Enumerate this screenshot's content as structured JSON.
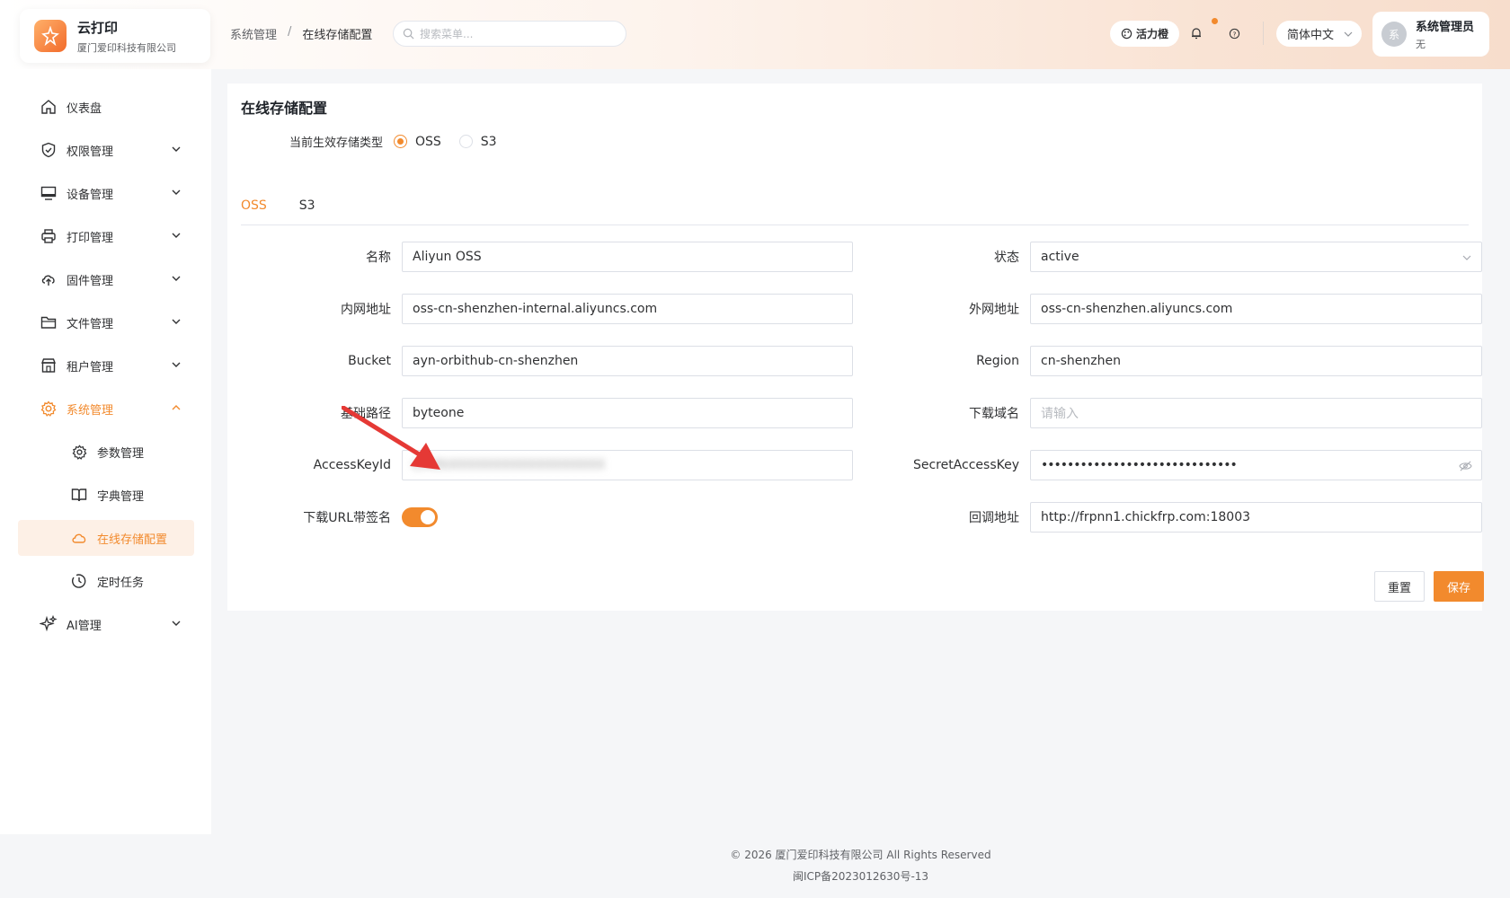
{
  "brand": {
    "title": "云打印",
    "subtitle": "厦门爱印科技有限公司"
  },
  "breadcrumb": {
    "parent": "系统管理",
    "separator": "/",
    "current": "在线存储配置"
  },
  "search": {
    "placeholder": "搜索菜单..."
  },
  "header": {
    "vitality_label": "活力橙",
    "language": "简体中文",
    "avatar_text": "系",
    "user_name": "系统管理员",
    "user_role": "无",
    "accent": "#f28a2d"
  },
  "sidebar": {
    "items": [
      {
        "label": "仪表盘",
        "icon": "home-icon"
      },
      {
        "label": "权限管理",
        "icon": "shield-icon"
      },
      {
        "label": "设备管理",
        "icon": "monitor-icon"
      },
      {
        "label": "打印管理",
        "icon": "printer-icon"
      },
      {
        "label": "固件管理",
        "icon": "cloud-upload-icon"
      },
      {
        "label": "文件管理",
        "icon": "folder-icon"
      },
      {
        "label": "租户管理",
        "icon": "store-icon"
      },
      {
        "label": "系统管理",
        "icon": "gear-icon"
      },
      {
        "label": "参数管理",
        "icon": "cog-icon"
      },
      {
        "label": "字典管理",
        "icon": "book-icon"
      },
      {
        "label": "在线存储配置",
        "icon": "cloud-icon"
      },
      {
        "label": "定时任务",
        "icon": "clock-icon"
      },
      {
        "label": "AI管理",
        "icon": "sparkle-icon"
      }
    ]
  },
  "page": {
    "title": "在线存储配置",
    "storage_type_label": "当前生效存储类型",
    "storage_types": [
      "OSS",
      "S3"
    ],
    "selected_type": "OSS",
    "tabs": [
      "OSS",
      "S3"
    ],
    "active_tab": "OSS"
  },
  "form": {
    "name_label": "名称",
    "name_value": "Aliyun OSS",
    "status_label": "状态",
    "status_value": "active",
    "internal_label": "内网地址",
    "internal_value": "oss-cn-shenzhen-internal.aliyuncs.com",
    "external_label": "外网地址",
    "external_value": "oss-cn-shenzhen.aliyuncs.com",
    "bucket_label": "Bucket",
    "bucket_value": "ayn-orbithub-cn-shenzhen",
    "region_label": "Region",
    "region_value": "cn-shenzhen",
    "base_path_label": "基础路径",
    "base_path_value": "byteone",
    "download_domain_label": "下载域名",
    "download_domain_placeholder": "请输入",
    "access_key_label": "AccessKeyId",
    "access_key_value": "LTAI5tXXXXXXXXXXXXXXXXXX",
    "secret_label": "SecretAccessKey",
    "secret_value": "••••••••••••••••••••••••••••••",
    "signed_url_label": "下载URL带签名",
    "signed_url_on": true,
    "callback_label": "回调地址",
    "callback_value": "http://frpnn1.chickfrp.com:18003"
  },
  "actions": {
    "reset": "重置",
    "save": "保存"
  },
  "footer": {
    "copyright": "© 2026 厦门爱印科技有限公司 All Rights Reserved",
    "icp": "闽ICP备2023012630号-13"
  }
}
